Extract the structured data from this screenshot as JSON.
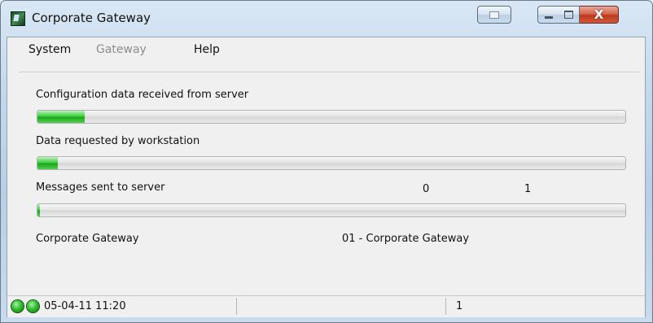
{
  "window": {
    "title": "Corporate Gateway"
  },
  "title_buttons": {
    "close": "X"
  },
  "menu": {
    "items": [
      {
        "label": "System",
        "enabled": true
      },
      {
        "label": "Gateway",
        "enabled": false
      },
      {
        "label": "Help",
        "enabled": true
      }
    ]
  },
  "progress": [
    {
      "label": "Configuration data received from server",
      "fraction": 0.08
    },
    {
      "label": "Data requested by workstation",
      "fraction": 0.035
    },
    {
      "label": "Messages sent to server",
      "fraction": 0.004,
      "value_a": "0",
      "value_b": "1"
    }
  ],
  "info": {
    "left": "Corporate Gateway",
    "right": "01 - Corporate Gateway"
  },
  "status": {
    "datetime": "05-04-11 11:20",
    "panel3": "1"
  },
  "colors": {
    "progress_fill": "#2bbf2b",
    "led": "#2fbf2f",
    "close_button": "#c9442a"
  },
  "icons": {
    "app": "app-icon",
    "min": "minimize-icon",
    "max": "maximize-icon",
    "close": "close-icon",
    "extra": "restore-icon",
    "led": "status-led-icon"
  }
}
